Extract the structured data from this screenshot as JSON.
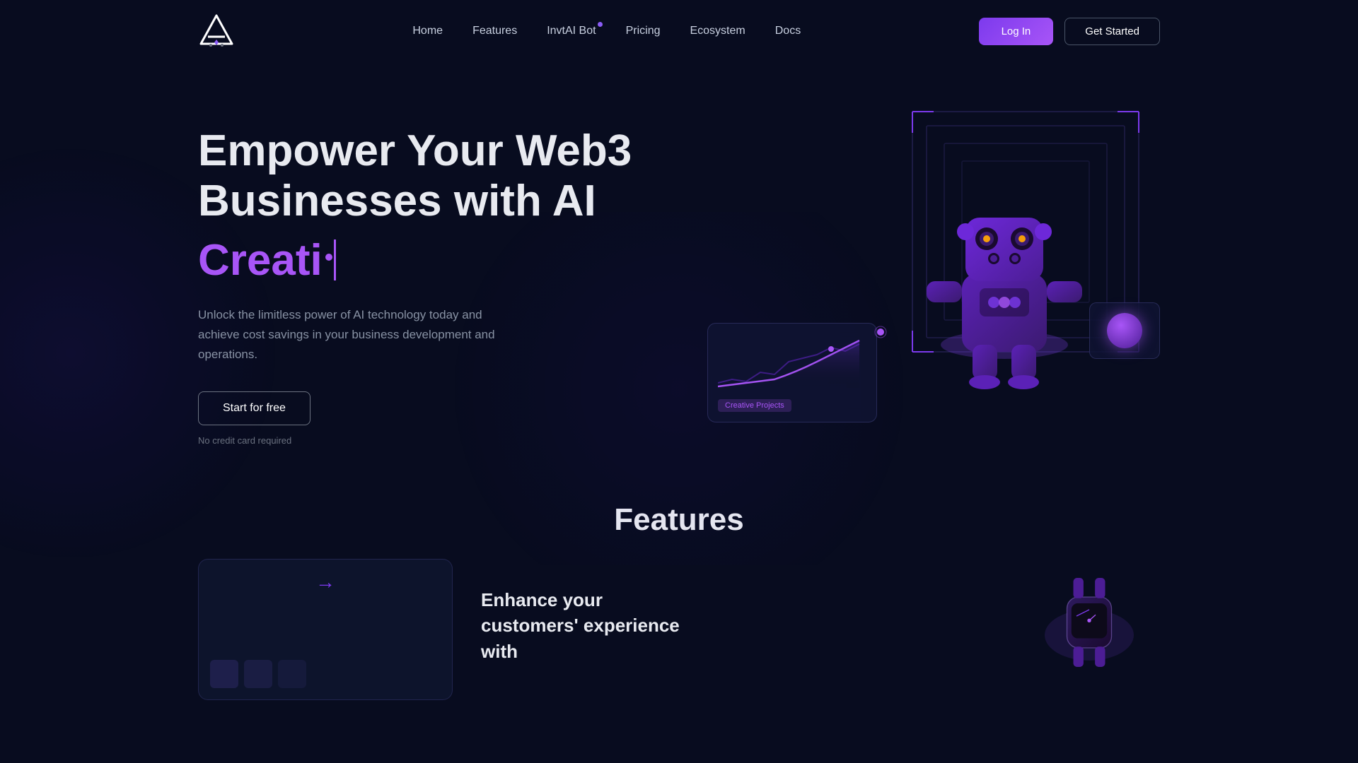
{
  "nav": {
    "logo_alt": "InvtAI Logo",
    "links": [
      {
        "id": "home",
        "label": "Home",
        "active": true,
        "has_badge": false
      },
      {
        "id": "features",
        "label": "Features",
        "active": false,
        "has_badge": false
      },
      {
        "id": "invtai-bot",
        "label": "InvtAI Bot",
        "active": false,
        "has_badge": true
      },
      {
        "id": "pricing",
        "label": "Pricing",
        "active": false,
        "has_badge": false
      },
      {
        "id": "ecosystem",
        "label": "Ecosystem",
        "active": false,
        "has_badge": false
      },
      {
        "id": "docs",
        "label": "Docs",
        "active": false,
        "has_badge": false
      }
    ],
    "login_label": "Log In",
    "get_started_label": "Get Started"
  },
  "hero": {
    "title_line1": "Empower Your Web3",
    "title_line2": "Businesses with AI",
    "animated_word": "Creati",
    "description": "Unlock the limitless power of AI technology today and achieve cost savings in your business development and operations.",
    "cta_primary": "Start for free",
    "cta_note": "No credit card required",
    "dashboard_card_label": "Creative Projects"
  },
  "features": {
    "title": "Features",
    "enhance_text": "Enhance your customers' experience with"
  }
}
